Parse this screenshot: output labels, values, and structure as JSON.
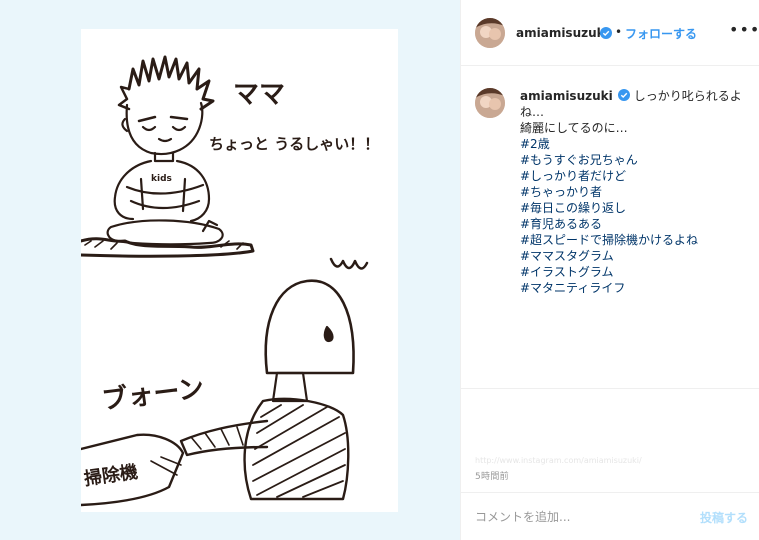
{
  "post": {
    "username": "amiamisuzuki",
    "follow_separator": "•",
    "follow_label": "フォローする",
    "more_icon": "•••",
    "verified_color": "#3897f0"
  },
  "drawing": {
    "text_mama": "ママ",
    "text_speech": "ちょっと うるしゃい！！",
    "text_kids": "kids",
    "text_boon": "ブォーン",
    "text_vacuum": "掃除機"
  },
  "caption": {
    "username": "amiamisuzuki",
    "lines": [
      "しっかり叱られるよね…",
      "綺麗にしてるのに…"
    ],
    "hashtags": [
      "#2歳",
      "#もうすぐお兄ちゃん",
      "#しっかり者だけど",
      "#ちゃっかり者",
      "#毎日この繰り返し",
      "#育児あるある",
      "#超スピードで掃除機かけるよね",
      "#ママスタグラム",
      "#イラストグラム",
      "#マタニティライフ"
    ]
  },
  "meta": {
    "faded_text": "http://www.instagram.com/amiamisuzuki/",
    "timestamp": "5時間前"
  },
  "comment": {
    "placeholder": "コメントを追加...",
    "post_label": "投稿する"
  }
}
